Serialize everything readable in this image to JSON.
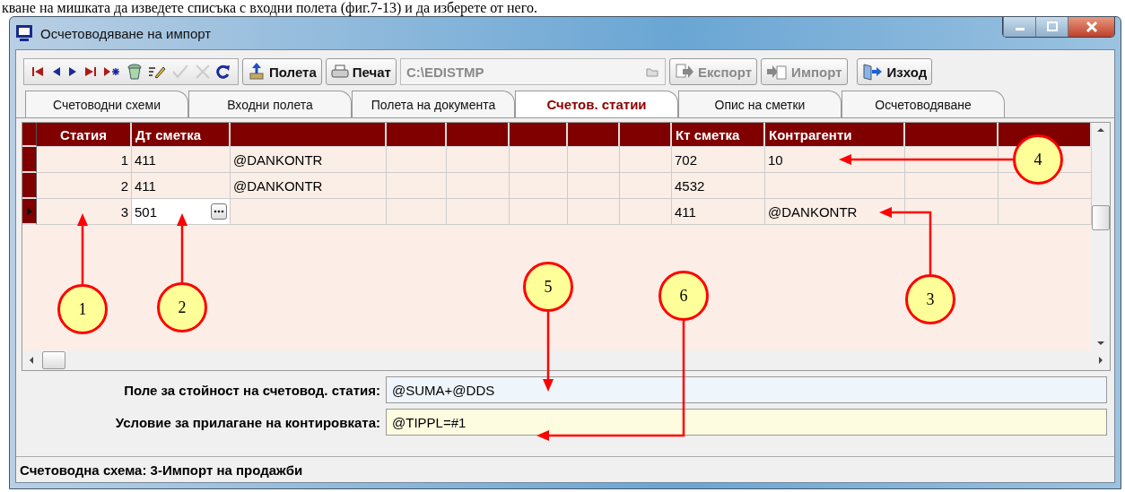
{
  "caption": "кване на мишката да изведете списъка с входни полета (фиг.7-13) и да изберете от него.",
  "window": {
    "title": "Осчетоводяване на импорт"
  },
  "toolbar": {
    "nav_buttons": [
      {
        "kind": "first",
        "disabled": false
      },
      {
        "kind": "prev",
        "disabled": false
      },
      {
        "kind": "next",
        "disabled": false
      },
      {
        "kind": "last",
        "disabled": false
      },
      {
        "kind": "insert",
        "disabled": false
      },
      {
        "kind": "delete",
        "disabled": false
      },
      {
        "kind": "edit",
        "disabled": false
      },
      {
        "kind": "post",
        "disabled": true
      },
      {
        "kind": "cancel",
        "disabled": true
      },
      {
        "kind": "refresh",
        "disabled": false
      }
    ],
    "fields_button": {
      "label": "Полета",
      "disabled": false
    },
    "print_button": {
      "label": "Печат",
      "disabled": false
    },
    "path": {
      "value": "C:\\EDISTMP",
      "disabled": true
    },
    "export_button": {
      "label": "Експорт",
      "disabled": true
    },
    "import_button": {
      "label": "Импорт",
      "disabled": true
    },
    "exit_button": {
      "label": "Изход",
      "disabled": false
    }
  },
  "tabs": [
    {
      "label": "Счетоводни схеми",
      "selected": false
    },
    {
      "label": "Входни полета",
      "selected": false
    },
    {
      "label": "Полета на документа",
      "selected": false
    },
    {
      "label": "Счетов. статии",
      "selected": true
    },
    {
      "label": "Опис на сметки",
      "selected": false
    },
    {
      "label": "Осчетоводяване",
      "selected": false
    }
  ],
  "table": {
    "columns": [
      "Статия",
      "Дт сметка",
      null,
      null,
      null,
      null,
      null,
      null,
      "Кт сметка",
      "Контрагенти",
      null,
      null
    ],
    "rows": [
      {
        "selected": false,
        "cells": [
          "1",
          "411",
          "@DANKONTR",
          null,
          null,
          null,
          null,
          null,
          "702",
          "10",
          null,
          null
        ]
      },
      {
        "selected": false,
        "cells": [
          "2",
          "411",
          "@DANKONTR",
          null,
          null,
          null,
          null,
          null,
          "4532",
          null,
          null,
          null
        ]
      },
      {
        "selected": true,
        "cells": [
          "3",
          "501",
          null,
          null,
          null,
          null,
          null,
          null,
          "411",
          "@DANKONTR",
          null,
          null
        ]
      }
    ]
  },
  "fields": [
    {
      "label": "Поле за стойност на счетовод. статия:",
      "value": "@SUMA+@DDS",
      "color": "#eef6fb"
    },
    {
      "label": "Условие за прилагане на контировката:",
      "value": "@TIPPL=#1",
      "color": "#fdfbe0"
    }
  ],
  "status_bar": {
    "text": "Счетоводна схема: 3-Импорт на продажби"
  },
  "callouts": [
    {
      "number": "1"
    },
    {
      "number": "2"
    },
    {
      "number": "3"
    },
    {
      "number": "4"
    },
    {
      "number": "5"
    },
    {
      "number": "6"
    }
  ]
}
